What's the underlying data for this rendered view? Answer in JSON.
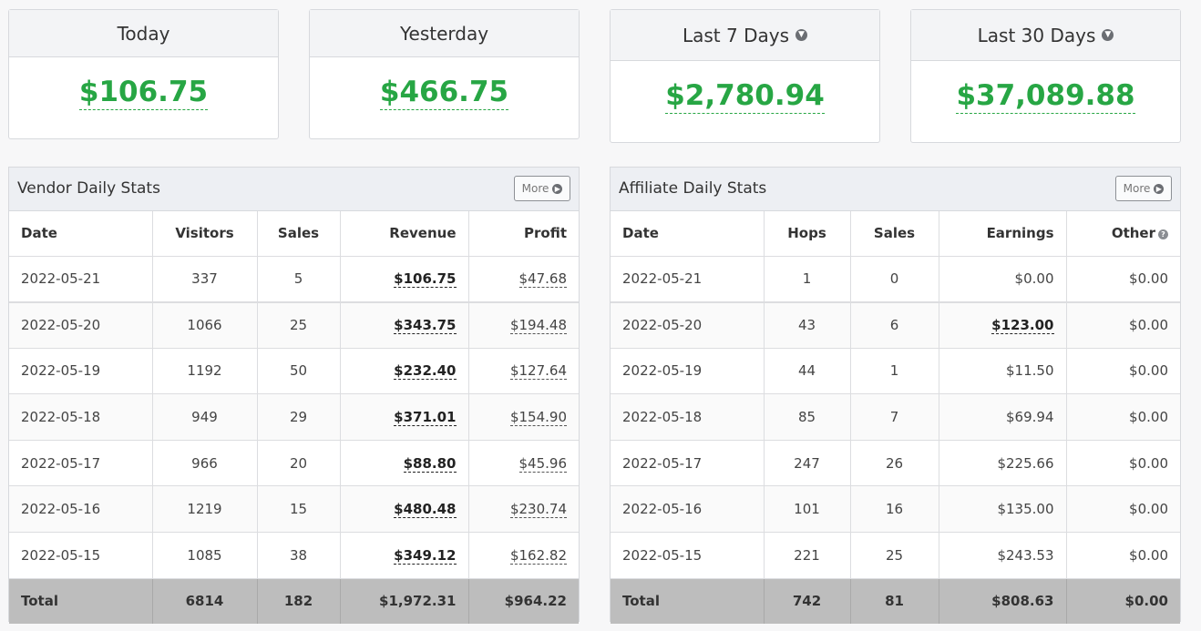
{
  "summary": [
    {
      "label": "Today",
      "value": "$106.75",
      "dropdown": false
    },
    {
      "label": "Yesterday",
      "value": "$466.75",
      "dropdown": false
    },
    {
      "label": "Last 7 Days",
      "value": "$2,780.94",
      "dropdown": true
    },
    {
      "label": "Last 30 Days",
      "value": "$37,089.88",
      "dropdown": true
    }
  ],
  "vendor": {
    "title": "Vendor Daily Stats",
    "more": "More",
    "headers": [
      "Date",
      "Visitors",
      "Sales",
      "Revenue",
      "Profit"
    ],
    "rows": [
      [
        "2022-05-21",
        "337",
        "5",
        "$106.75",
        "$47.68"
      ],
      [
        "2022-05-20",
        "1066",
        "25",
        "$343.75",
        "$194.48"
      ],
      [
        "2022-05-19",
        "1192",
        "50",
        "$232.40",
        "$127.64"
      ],
      [
        "2022-05-18",
        "949",
        "29",
        "$371.01",
        "$154.90"
      ],
      [
        "2022-05-17",
        "966",
        "20",
        "$88.80",
        "$45.96"
      ],
      [
        "2022-05-16",
        "1219",
        "15",
        "$480.48",
        "$230.74"
      ],
      [
        "2022-05-15",
        "1085",
        "38",
        "$349.12",
        "$162.82"
      ]
    ],
    "total": [
      "Total",
      "6814",
      "182",
      "$1,972.31",
      "$964.22"
    ]
  },
  "affiliate": {
    "title": "Affiliate Daily Stats",
    "more": "More",
    "headers": [
      "Date",
      "Hops",
      "Sales",
      "Earnings",
      "Other"
    ],
    "rows": [
      [
        "2022-05-21",
        "1",
        "0",
        "$0.00",
        "$0.00"
      ],
      [
        "2022-05-20",
        "43",
        "6",
        "$123.00",
        "$0.00"
      ],
      [
        "2022-05-19",
        "44",
        "1",
        "$11.50",
        "$0.00"
      ],
      [
        "2022-05-18",
        "85",
        "7",
        "$69.94",
        "$0.00"
      ],
      [
        "2022-05-17",
        "247",
        "26",
        "$225.66",
        "$0.00"
      ],
      [
        "2022-05-16",
        "101",
        "16",
        "$135.00",
        "$0.00"
      ],
      [
        "2022-05-15",
        "221",
        "25",
        "$243.53",
        "$0.00"
      ]
    ],
    "total": [
      "Total",
      "742",
      "81",
      "$808.63",
      "$0.00"
    ]
  },
  "colors": {
    "accent_green": "#27a644",
    "total_row": "#bdbdbd",
    "header_bg": "#edeff3"
  },
  "icons": {
    "dropdown": "chevron-down-circle-icon",
    "more": "chevron-right-circle-icon",
    "help": "question-circle-icon"
  }
}
